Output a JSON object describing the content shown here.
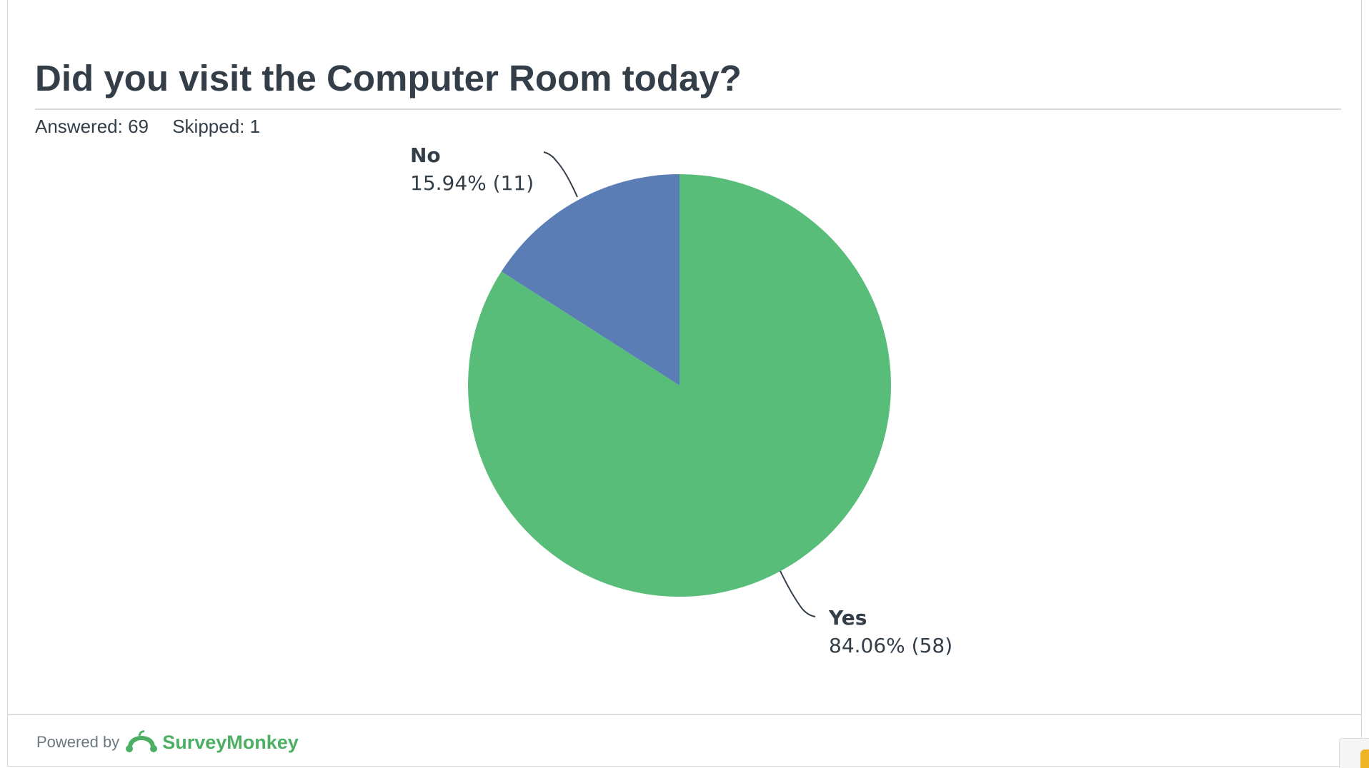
{
  "page": {
    "title": "Did you visit the Computer Room today?",
    "answered": "Answered: 69",
    "skipped": "Skipped: 1"
  },
  "footer": {
    "powered_by": "Powered by",
    "brand": "SurveyMonkey",
    "brand_icon": "surveymonkey-logo-icon",
    "brand_color": "#4caf64"
  },
  "chart_data": {
    "type": "pie",
    "slices": [
      {
        "name": "No",
        "label": "15.94% (11)",
        "percent": 15.94,
        "count": 11,
        "color": "#5a7db5"
      },
      {
        "name": "Yes",
        "label": "84.06% (58)",
        "percent": 84.06,
        "count": 58,
        "color": "#57bd79"
      }
    ],
    "start_angle_deg": 0,
    "direction": "counterclockwise-from-top",
    "legend": "none"
  }
}
